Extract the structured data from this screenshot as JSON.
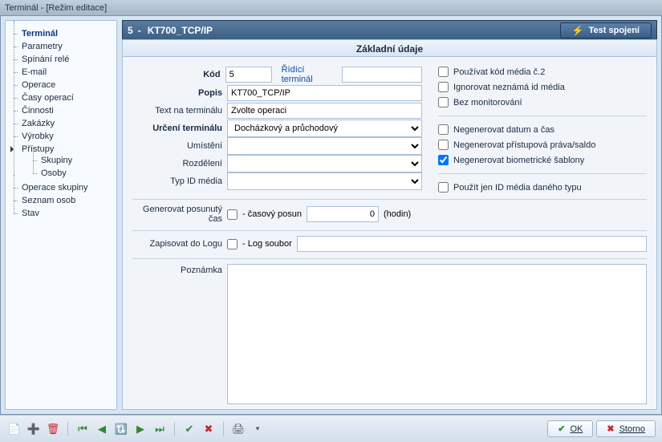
{
  "window": {
    "title": "Terminál - [Režim editace]"
  },
  "header": {
    "id": "5",
    "sep": "-",
    "name": "KT700_TCP/IP",
    "test_label": "Test spojení"
  },
  "section": {
    "title": "Základní údaje"
  },
  "sidebar": {
    "items": [
      {
        "label": "Terminál"
      },
      {
        "label": "Parametry"
      },
      {
        "label": "Spínání relé"
      },
      {
        "label": "E-mail"
      },
      {
        "label": "Operace"
      },
      {
        "label": "Časy operací"
      },
      {
        "label": "Činnosti"
      },
      {
        "label": "Zakázky"
      },
      {
        "label": "Výrobky"
      },
      {
        "label": "Přístupy",
        "children": [
          {
            "label": "Skupiny"
          },
          {
            "label": "Osoby"
          }
        ]
      },
      {
        "label": "Operace skupiny"
      },
      {
        "label": "Seznam osob"
      },
      {
        "label": "Stav"
      }
    ]
  },
  "form": {
    "kod_label": "Kód",
    "kod_value": "5",
    "ridici_link": "Řídící terminál",
    "ridici_value": "",
    "popis_label": "Popis",
    "popis_value": "KT700_TCP/IP",
    "text_label": "Text na terminálu",
    "text_value": "Zvolte operaci",
    "urceni_label": "Určení terminálu",
    "urceni_value": "Docházkový a průchodový",
    "umisteni_label": "Umístění",
    "umisteni_value": "",
    "rozdeleni_label": "Rozdělení",
    "rozdeleni_value": "",
    "typid_label": "Typ ID média",
    "typid_value": "",
    "gen_label": "Generovat posunutý čas",
    "gen_sublabel": "- časový posun",
    "gen_value": "0",
    "gen_unit": "(hodin)",
    "log_label": "Zapisovat do Logu",
    "log_sublabel": "- Log soubor",
    "log_value": "",
    "note_label": "Poznámka",
    "note_value": ""
  },
  "checks": {
    "c1": "Používat kód média č.2",
    "c2": "Ignorovat neznámá id média",
    "c3": "Bez monitorování",
    "c4": "Negenerovat datum a čas",
    "c5": "Negenerovat přístupová práva/saldo",
    "c6": "Negenerovat biometrické šablony",
    "c7": "Použít jen ID média daného typu"
  },
  "buttons": {
    "ok": "OK",
    "storno": "Storno"
  }
}
